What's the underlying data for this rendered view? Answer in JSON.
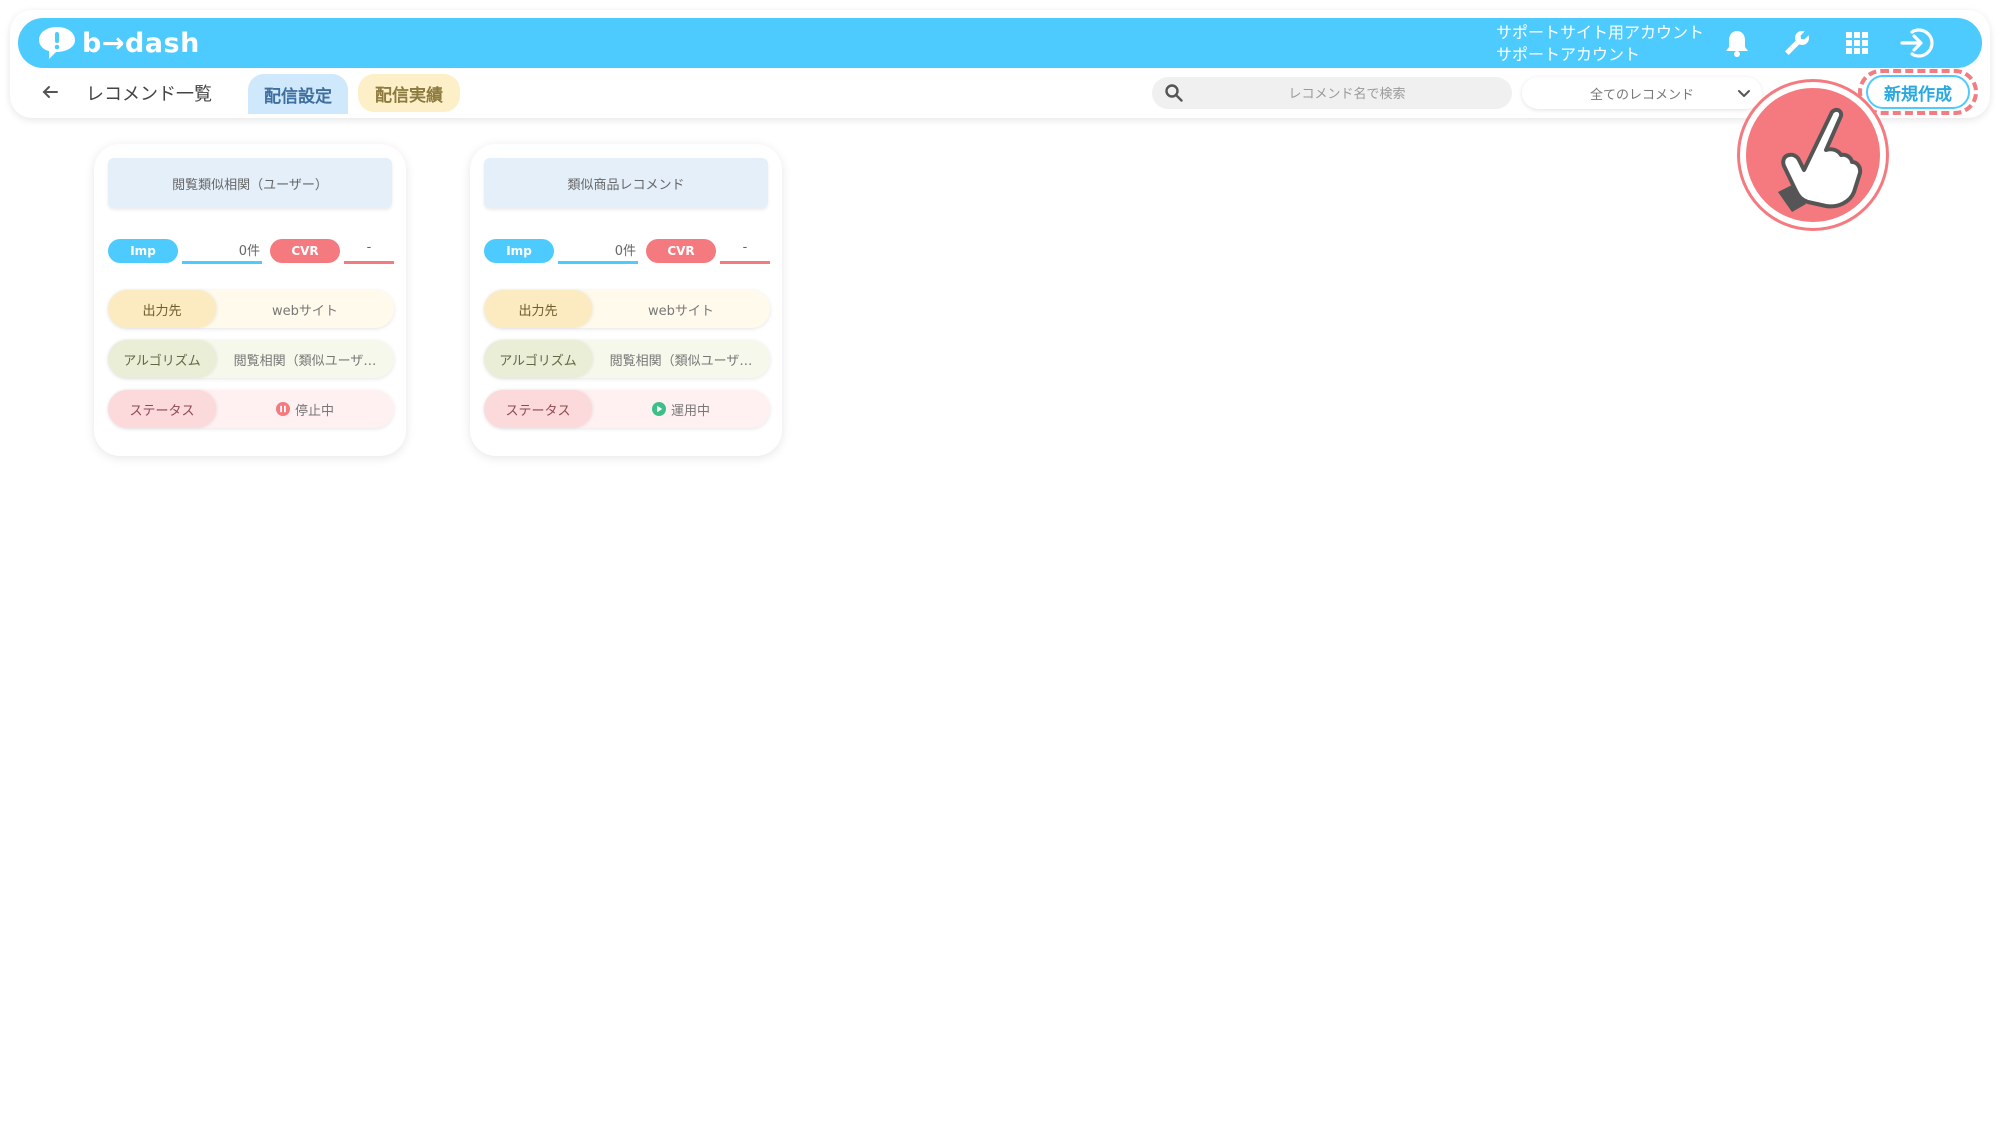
{
  "header": {
    "logo_text": "b→dash",
    "account_line1": "サポートサイト用アカウント",
    "account_line2": "サポートアカウント",
    "icons": [
      "bell-icon",
      "wrench-icon",
      "grid-icon",
      "logout-icon"
    ]
  },
  "subbar": {
    "title": "レコメンド一覧",
    "tabs": [
      {
        "label": "配信設定",
        "active": true
      },
      {
        "label": "配信実績",
        "active": false
      }
    ],
    "search_placeholder": "レコメンド名で検索",
    "filter_selected": "全てのレコメンド",
    "new_button": "新規作成"
  },
  "labels": {
    "imp": "Imp",
    "cvr": "CVR",
    "output": "出力先",
    "algorithm": "アルゴリズム",
    "status": "ステータス"
  },
  "cards": [
    {
      "title": "閲覧類似相関（ユーザー）",
      "imp_value": "0件",
      "cvr_value": "-",
      "output": "webサイト",
      "algorithm": "閲覧相関（類似ユーザ…",
      "status": "停止中",
      "status_kind": "paused"
    },
    {
      "title": "類似商品レコメンド",
      "imp_value": "0件",
      "cvr_value": "-",
      "output": "webサイト",
      "algorithm": "閲覧相関（類似ユーザ…",
      "status": "運用中",
      "status_kind": "running"
    }
  ],
  "colors": {
    "brand": "#4dcbff",
    "imp": "#4dcbff",
    "cvr": "#f47a80",
    "paused": "#f47a80",
    "running": "#3dbf8a"
  }
}
